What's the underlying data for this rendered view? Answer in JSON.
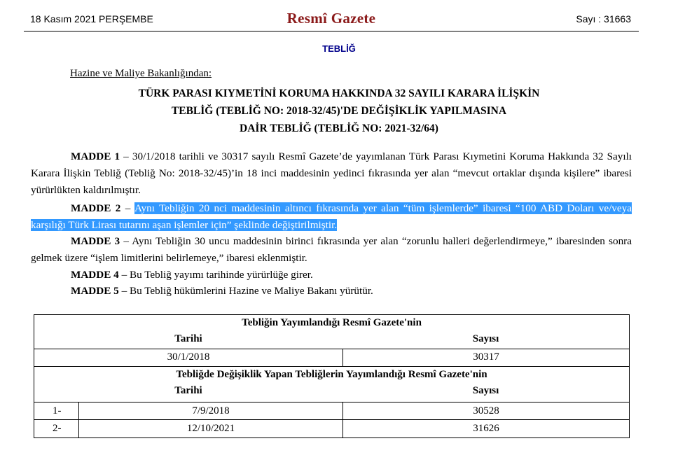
{
  "header": {
    "date": "18 Kasım 2021 PERŞEMBE",
    "title": "Resmî Gazete",
    "issue": "Sayı : 31663"
  },
  "section": "TEBLİĞ",
  "ministry": "Hazine ve Maliye Bakanlığından:",
  "doc_title": [
    "TÜRK PARASI KIYMETİNİ KORUMA HAKKINDA 32 SAYILI KARARA İLİŞKİN",
    "TEBLİĞ (TEBLİĞ NO: 2018-32/45)'DE DEĞİŞİKLİK YAPILMASINA",
    "DAİR TEBLİĞ (TEBLİĞ NO: 2021-32/64)"
  ],
  "articles": [
    {
      "label": "MADDE 1",
      "sep": " – ",
      "text": "30/1/2018 tarihli ve 30317 sayılı Resmî Gazete’de yayımlanan Türk Parası Kıymetini Koruma Hakkında 32 Sayılı Karara İlişkin Tebliğ (Tebliğ No: 2018-32/45)’in 18 inci maddesinin yedinci fıkrasında yer alan “mevcut ortaklar dışında kişilere” ibaresi yürürlükten kaldırılmıştır."
    },
    {
      "label": "MADDE 2",
      "sep": " – ",
      "text": "Aynı Tebliğin 20 nci maddesinin altıncı fıkrasında yer alan “tüm işlemlerde” ibaresi “100 ABD Doları ve/veya karşılığı Türk Lirası tutarını aşan işlemler için” şeklinde değiştirilmiştir."
    },
    {
      "label": "MADDE 3",
      "sep": " – ",
      "text": "Aynı Tebliğin 30 uncu maddesinin birinci fıkrasında yer alan “zorunlu halleri değerlendirmeye,” ibaresinden sonra gelmek üzere “işlem limitlerini belirlemeye,” ibaresi eklenmiştir."
    },
    {
      "label": "MADDE 4",
      "sep": " – ",
      "text": "Bu Tebliğ yayımı tarihinde yürürlüğe girer."
    },
    {
      "label": "MADDE 5",
      "sep": " – ",
      "text": "Bu Tebliğ hükümlerini Hazine ve Maliye Bakanı yürütür."
    }
  ],
  "table": {
    "heading1": "Tebliğin Yayımlandığı Resmî Gazete'nin",
    "col_date": "Tarihi",
    "col_number": "Sayısı",
    "original": {
      "date": "30/1/2018",
      "number": "30317"
    },
    "heading2": "Tebliğde Değişiklik Yapan Tebliğlerin Yayımlandığı Resmî Gazete'nin",
    "amendments": [
      {
        "index": "1-",
        "date": "7/9/2018",
        "number": "30528"
      },
      {
        "index": "2-",
        "date": "12/10/2021",
        "number": "31626"
      }
    ]
  }
}
